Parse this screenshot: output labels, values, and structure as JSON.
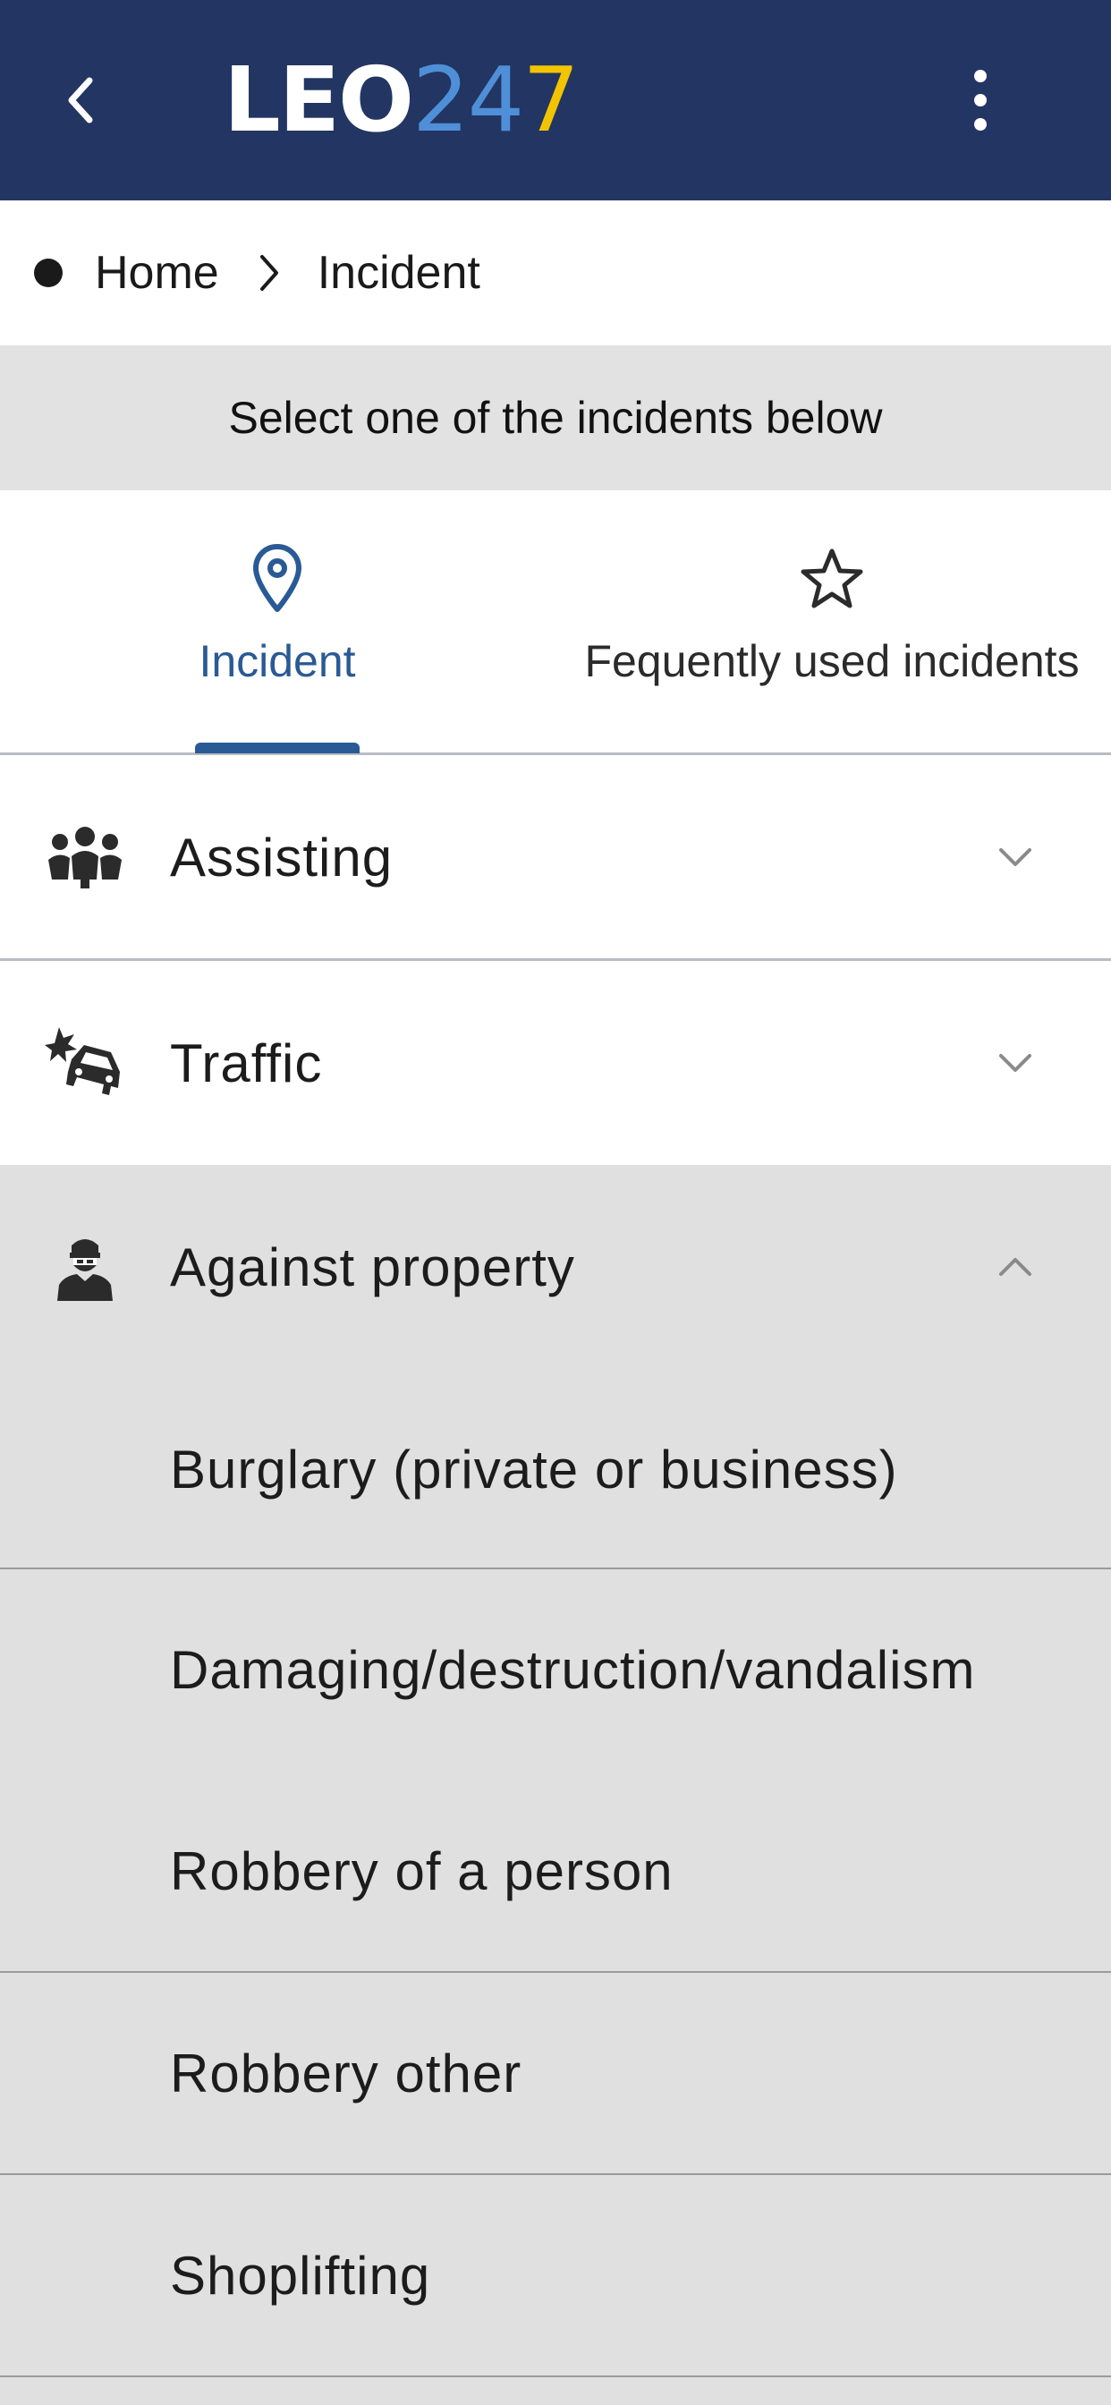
{
  "header": {
    "logo": {
      "leo": "LEO",
      "d2": "2",
      "d4": "4",
      "d7": "7"
    },
    "colors": {
      "background": "#233562",
      "logo_blue": "#4f8fd8",
      "logo_yellow": "#f2c400"
    }
  },
  "breadcrumb": {
    "home": "Home",
    "current": "Incident"
  },
  "instruction": "Select one of the incidents below",
  "tabs": [
    {
      "label": "Incident",
      "icon": "map-pin-icon",
      "active": true
    },
    {
      "label": "Fequently used incidents",
      "icon": "star-icon",
      "active": false
    }
  ],
  "categories": [
    {
      "label": "Assisting",
      "icon": "group-icon",
      "expanded": false
    },
    {
      "label": "Traffic",
      "icon": "car-crash-icon",
      "expanded": false
    },
    {
      "label": "Against property",
      "icon": "burglar-icon",
      "expanded": true,
      "items": [
        "Burglary (private or business)",
        "Damaging/destruction/vandalism",
        "Robbery of a person",
        "Robbery other",
        "Shoplifting"
      ]
    }
  ],
  "accent_color": "#2a5a95"
}
